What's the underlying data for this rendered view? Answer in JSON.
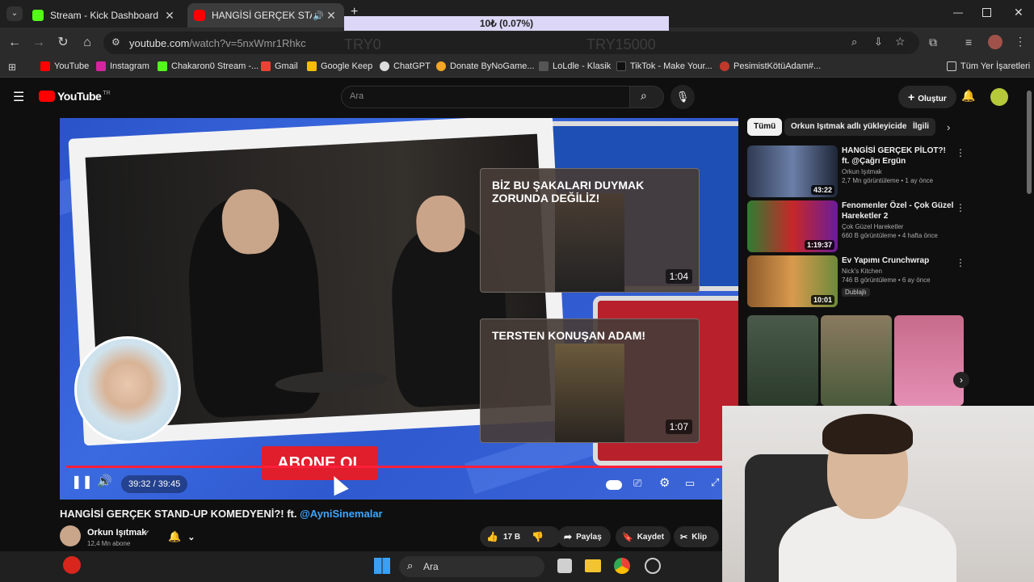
{
  "overlay": {
    "banner": "10₺ (0.07%)",
    "left_value": "TRY0",
    "right_value": "TRY15000"
  },
  "tabs": [
    {
      "label": "Stream - Kick Dashboard",
      "favicon_color": "#53fc18"
    },
    {
      "label": "HANGİSİ GERÇEK STAND-UP",
      "favicon_color": "#ff0000",
      "active": true
    }
  ],
  "address": {
    "host": "youtube.com",
    "path": "/watch?v=5nxWmr1Rhkc"
  },
  "bookmarks": [
    {
      "label": "YouTube",
      "color": "#ff0000"
    },
    {
      "label": "Instagram",
      "color": "#d6249f"
    },
    {
      "label": "Chakaron0 Stream -...",
      "color": "#53fc18"
    },
    {
      "label": "Gmail",
      "color": "#ea4335"
    },
    {
      "label": "Google Keep",
      "color": "#fbbc04"
    },
    {
      "label": "ChatGPT",
      "color": "#dddddd"
    },
    {
      "label": "Donate ByNoGame...",
      "color": "#f5a623"
    },
    {
      "label": "LoLdle - Klasik",
      "color": "#333333"
    },
    {
      "label": "TikTok - Make Your...",
      "color": "#111111"
    },
    {
      "label": "PesimistKötüAdam#...",
      "color": "#c0392b"
    }
  ],
  "bookmarks_all": "Tüm Yer İşaretleri",
  "youtube": {
    "logo": "YouTube",
    "region": "TR",
    "search_placeholder": "Ara",
    "create_label": "Oluştur"
  },
  "player": {
    "endcards": [
      {
        "title": "BİZ BU ŞAKALARI DUYMAK ZORUNDA DEĞİLİZ!",
        "duration": "1:04"
      },
      {
        "title": "TERSTEN KONUŞAN ADAM!",
        "duration": "1:07"
      }
    ],
    "subscribe_overlay": "ABONE OL",
    "time": "39:32 / 39:45",
    "progress": 0.995
  },
  "video": {
    "title": "HANGİSİ GERÇEK STAND-UP KOMEDYENİ?! ft.",
    "title_link": "@AyniSinemalar",
    "channel": "Orkun Işıtmak",
    "subscribers": "12,4 Mn abone",
    "likes": "17 B",
    "share": "Paylaş",
    "save": "Kaydet",
    "clip": "Klip"
  },
  "sidebar": {
    "chips": [
      "Tümü",
      "Orkun Işıtmak adlı yükleyiciden",
      "İlgili"
    ],
    "recommendations": [
      {
        "title": "HANGİSİ GERÇEK PİLOT?! ft. @Çağrı Ergün",
        "channel": "Orkun Işıtmak",
        "meta": "2,7 Mn görüntüleme • 1 ay önce",
        "duration": "43:22"
      },
      {
        "title": "Fenomenler Özel - Çok Güzel Hareketler 2",
        "channel": "Çok Güzel Hareketler",
        "meta": "660 B görüntüleme • 4 hafta önce",
        "duration": "1:19:37"
      },
      {
        "title": "Ev Yapımı Crunchwrap",
        "channel": "Nick's Kitchen",
        "meta": "746 B görüntüleme • 6 ay önce",
        "duration": "10:01",
        "badge": "Dublajlı"
      }
    ]
  },
  "taskbar": {
    "search": "Ara"
  }
}
